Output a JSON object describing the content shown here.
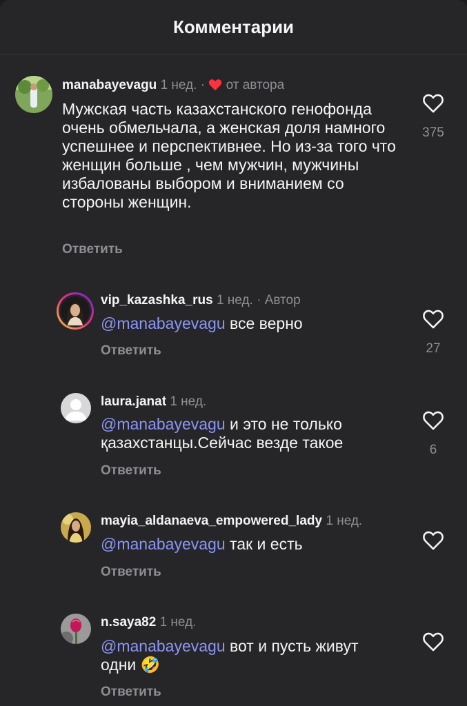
{
  "header": {
    "title": "Комментарии"
  },
  "comments": [
    {
      "username": "manabayevagu",
      "time": "1 нед.",
      "separator": "·",
      "tag": "от автора",
      "text": "Мужская часть казахстанского генофонда очень обмельчала, а женская доля намного успешнее и перспективнее. Но из-за того что женщин больше , чем мужчин, мужчины избалованы выбором и вниманием со стороны женщин.",
      "reply_label": "Ответить",
      "likes": "375"
    },
    {
      "username": "vip_kazashka_rus",
      "time": "1 нед.",
      "separator": "·",
      "tag": "Автор",
      "mention": "@manabayevagu",
      "text": " все верно",
      "reply_label": "Ответить",
      "likes": "27"
    },
    {
      "username": "laura.janat",
      "time": "1 нед.",
      "mention": "@manabayevagu",
      "text_line1": " и это не только",
      "text_line2": "қазахстанцы.Сейчас везде такое",
      "reply_label": "Ответить",
      "likes": "6"
    },
    {
      "username": "mayia_aldanaeva_empowered_lady",
      "time": "1 нед.",
      "mention": "@manabayevagu",
      "text": " так и есть",
      "reply_label": "Ответить"
    },
    {
      "username": "n.saya82",
      "time": "1 нед.",
      "mention": "@manabayevagu",
      "text_line1": " вот и пусть живут",
      "text_line2": "одни 🤣",
      "reply_label": "Ответить"
    }
  ],
  "icons": {
    "like": "heart-outline-icon",
    "author_like": "heart-filled-icon",
    "accent_red": "#ff3040",
    "mention_color": "#8b96f5"
  }
}
